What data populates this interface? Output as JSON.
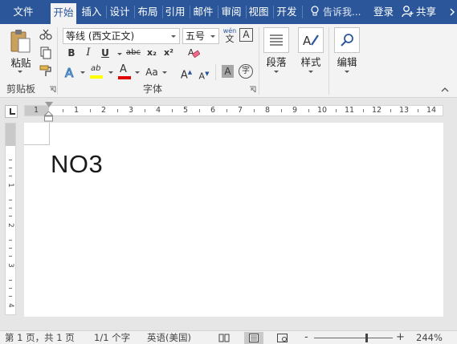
{
  "tabs": [
    {
      "label": "文件",
      "active": false
    },
    {
      "label": "开始",
      "active": true
    },
    {
      "label": "插入",
      "active": false
    },
    {
      "label": "设计",
      "active": false
    },
    {
      "label": "布局",
      "active": false
    },
    {
      "label": "引用",
      "active": false
    },
    {
      "label": "邮件",
      "active": false
    },
    {
      "label": "审阅",
      "active": false
    },
    {
      "label": "视图",
      "active": false
    },
    {
      "label": "开发",
      "active": false
    }
  ],
  "tell_me": "告诉我...",
  "login": "登录",
  "share": "共享",
  "clipboard": {
    "paste_label": "粘贴",
    "group_label": "剪贴板"
  },
  "font": {
    "group_label": "字体",
    "font_name": "等线 (西文正文)",
    "font_size": "五号",
    "phonetic_top": "wén",
    "phonetic_bottom": "文",
    "border_char": "A",
    "bold": "B",
    "italic": "I",
    "underline": "U",
    "strike": "abc",
    "subscript": "x₂",
    "superscript": "x²",
    "highlight": "ab",
    "font_color": "A",
    "change_case": "Aa",
    "grow": "A",
    "shrink": "A",
    "shading_char": "A",
    "enclose_char": "字"
  },
  "paragraph": {
    "label": "段落"
  },
  "styles": {
    "label": "样式"
  },
  "editing": {
    "label": "编辑"
  },
  "ruler": {
    "numbers": [
      "1",
      "1",
      "2",
      "3",
      "4",
      "5",
      "6",
      "7",
      "8",
      "9",
      "10",
      "11",
      "12",
      "13",
      "14"
    ]
  },
  "vruler": {
    "numbers": [
      "1",
      "2",
      "3",
      "4"
    ]
  },
  "document": {
    "text": "NO3"
  },
  "status": {
    "page": "第 1 页，共 1 页",
    "words": "1/1 个字",
    "language": "英语(美国)",
    "zoom_minus": "-",
    "zoom_plus": "+",
    "zoom": "244%"
  },
  "colors": {
    "title_bar": "#2b579a",
    "highlight": "#ffff00",
    "font_color": "#e00000"
  }
}
